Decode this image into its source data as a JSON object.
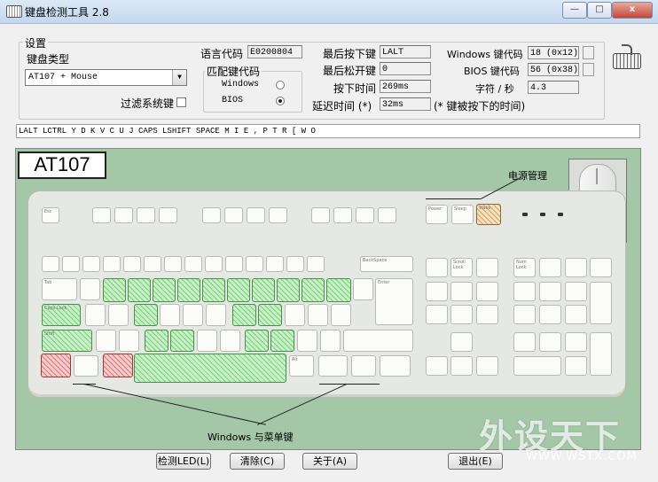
{
  "window": {
    "title": "键盘检测工具 2.8",
    "minimize": "—",
    "restore": "□",
    "close": "x"
  },
  "settings": {
    "group_label": "设置",
    "keyboard_type_label": "键盘类型",
    "keyboard_type_value": "AT107 + Mouse",
    "filter_label": "过滤系统键",
    "lang_code_label": "语言代码",
    "lang_code_value": "E0200804",
    "match_group_label": "匹配键代码",
    "match_windows": "Windows",
    "match_bios": "BIOS",
    "match_selected": "BIOS"
  },
  "status": {
    "last_pressed_label": "最后按下键",
    "last_pressed_value": "LALT",
    "last_released_label": "最后松开键",
    "last_released_value": "0",
    "press_time_label": "按下时间",
    "press_time_value": "269ms",
    "delay_label": "延迟时间 (*)",
    "delay_value": "32ms",
    "delay_note": "(* 键被按下的时间)",
    "win_code_label": "Windows 键代码",
    "win_code_value": "18 (0x12)",
    "bios_code_label": "BIOS 键代码",
    "bios_code_value": "56 (0x38)",
    "cps_label": "字符 / 秒",
    "cps_value": "4.3"
  },
  "key_log": "LALT LCTRL Y D K V C U J CAPS LSHIFT SPACE M I E , P T R [ W O",
  "keyboard": {
    "model_label": "AT107",
    "power_annotation": "电源管理",
    "windows_annotation": "Windows 与菜单键",
    "key_labels": {
      "esc": "Esc",
      "tab": "Tab",
      "bksp": "BackSpace",
      "enter": "Enter",
      "shift": "Shift",
      "alt": "Alt",
      "sleep": "Sleep",
      "wake": "Wake",
      "power": "Power",
      "numlock": "Num Lock",
      "caps_lock": "Caps Lock",
      "scroll_lock": "Scroll Lock"
    }
  },
  "buttons": {
    "detect_led": "检测LED(L)",
    "clear": "清除(C)",
    "about": "关于(A)",
    "exit": "退出(E)"
  },
  "watermark": {
    "brand": "外设天下",
    "url": "WWW.WSTX.COM"
  }
}
